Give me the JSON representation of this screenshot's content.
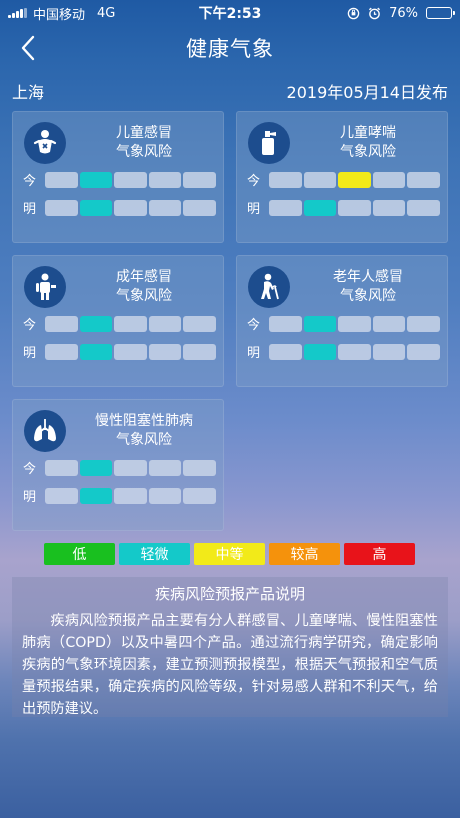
{
  "status": {
    "carrier": "中国移动",
    "network": "4G",
    "time": "下午2:53",
    "battery": "76%",
    "battery_level": 0.76
  },
  "nav": {
    "title": "健康气象",
    "back_icon": "chevron-left-icon"
  },
  "location": {
    "city": "上海",
    "publish": "2019年05月14日发布"
  },
  "row_labels": {
    "today": "今",
    "tomorrow": "明"
  },
  "colors": {
    "low": "#19c01f",
    "mild": "#14c9c9",
    "medium": "#f2ea19",
    "high": "#f5920c",
    "very_high": "#e8131a",
    "inactive": "#c8d4e8"
  },
  "cards": [
    {
      "name": "child-cold",
      "title1": "儿童感冒",
      "title2": "气象风险",
      "icon": "baby-icon",
      "today": 1,
      "tomorrow": 1,
      "today_color": "mild",
      "tomorrow_color": "mild"
    },
    {
      "name": "child-asthma",
      "title1": "儿童哮喘",
      "title2": "气象风险",
      "icon": "inhaler-icon",
      "today": 2,
      "tomorrow": 1,
      "today_color": "medium",
      "tomorrow_color": "mild"
    },
    {
      "name": "adult-cold",
      "title1": "成年感冒",
      "title2": "气象风险",
      "icon": "adult-icon",
      "today": 1,
      "tomorrow": 1,
      "today_color": "mild",
      "tomorrow_color": "mild"
    },
    {
      "name": "elderly-cold",
      "title1": "老年人感冒",
      "title2": "气象风险",
      "icon": "elderly-icon",
      "today": 1,
      "tomorrow": 1,
      "today_color": "mild",
      "tomorrow_color": "mild"
    },
    {
      "name": "copd",
      "title1": "慢性阻塞性肺病",
      "title2": "气象风险",
      "icon": "lungs-icon",
      "today": 1,
      "tomorrow": 1,
      "today_color": "mild",
      "tomorrow_color": "mild"
    }
  ],
  "legend": [
    {
      "label": "低",
      "color": "low"
    },
    {
      "label": "轻微",
      "color": "mild"
    },
    {
      "label": "中等",
      "color": "medium"
    },
    {
      "label": "较高",
      "color": "high"
    },
    {
      "label": "高",
      "color": "very_high"
    }
  ],
  "description": {
    "title": "疾病风险预报产品说明",
    "text": "疾病风险预报产品主要有分人群感冒、儿童哮喘、慢性阻塞性肺病（COPD）以及中暑四个产品。通过流行病学研究，确定影响疾病的气象环境因素，建立预测预报模型，根据天气预报和空气质量预报结果，确定疾病的风险等级，针对易感人群和不利天气，给出预防建议。"
  }
}
